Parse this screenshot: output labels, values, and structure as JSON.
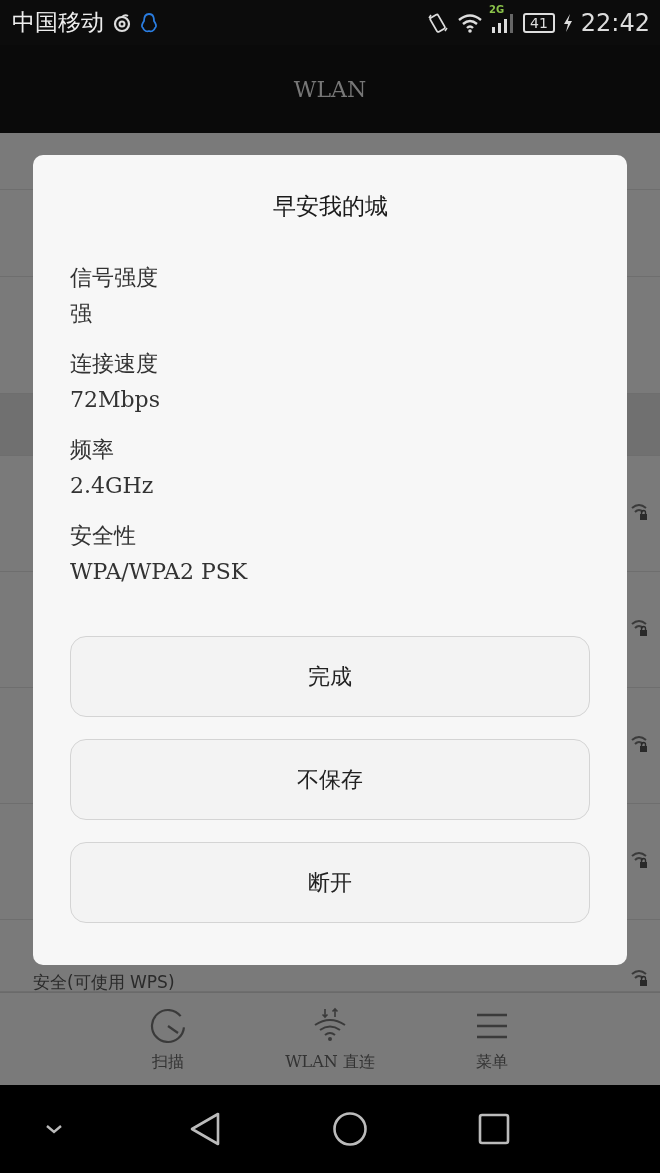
{
  "status_bar": {
    "carrier": "中国移动",
    "network": "2G",
    "battery": "41",
    "time": "22:42"
  },
  "header": {
    "title": "WLAN"
  },
  "background_list": {
    "last_row_text": "安全(可使用 WPS)"
  },
  "dialog": {
    "title": "早安我的城",
    "fields": [
      {
        "label": "信号强度",
        "value": "强"
      },
      {
        "label": "连接速度",
        "value": "72Mbps"
      },
      {
        "label": "频率",
        "value": "2.4GHz"
      },
      {
        "label": "安全性",
        "value": "WPA/WPA2 PSK"
      }
    ],
    "buttons": [
      "完成",
      "不保存",
      "断开"
    ]
  },
  "toolbar": [
    {
      "kind": "scan",
      "label": "扫描"
    },
    {
      "kind": "direct",
      "label": "WLAN 直连"
    },
    {
      "kind": "menu",
      "label": "菜单"
    }
  ]
}
